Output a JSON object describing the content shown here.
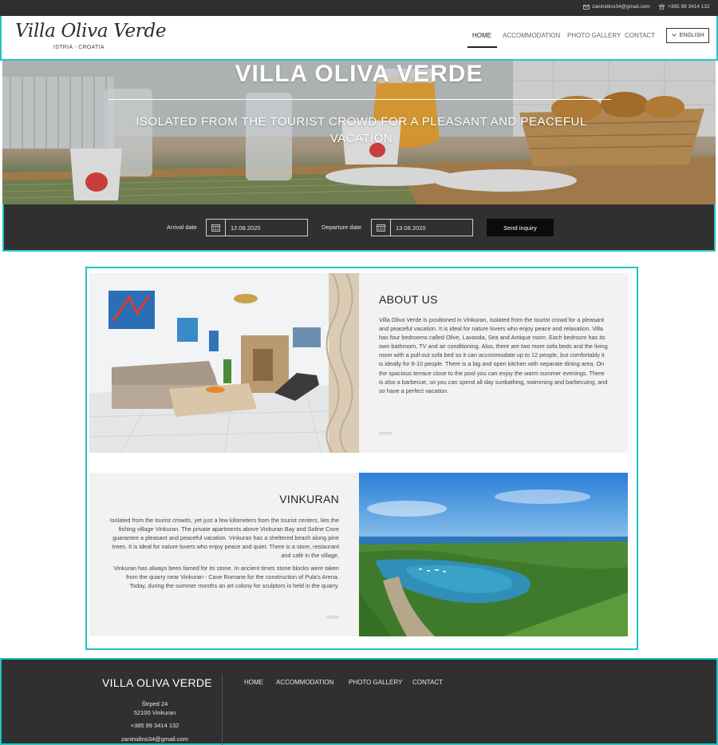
{
  "topbar": {
    "email": "zaninidino34@gmail.com",
    "phone": "+385 99 3414 132"
  },
  "header": {
    "logo_script": "Villa Oliva Verde",
    "logo_sub": "ISTRIA - CROATIA",
    "nav": [
      "HOME",
      "ACCOMMODATION",
      "PHOTO GALLERY",
      "CONTACT"
    ],
    "active_nav": "HOME",
    "language": "ENGLISH"
  },
  "hero": {
    "title": "VILLA OLIVA VERDE",
    "subtitle": "ISOLATED FROM THE TOURIST CROWD FOR A PLEASANT AND PEACEFUL VACATION"
  },
  "booking": {
    "arrival_label": "Arrival date",
    "arrival_value": "12.08.2020",
    "departure_label": "Departure date",
    "departure_value": "13.08.2020",
    "send_label": "Send inquiry"
  },
  "about": {
    "title": "ABOUT US",
    "body": "Villa Oliva Verde is positioned in Vinkuran, isolated from the tourist crowd for a pleasant and peaceful vacation. It is ideal for nature lovers who enjoy peace and relaxation. Villa has four bedrooms called Olive, Lavanda, Sea and Antique room. Each bedroom has its own bathroom, TV and air conditioning. Also, there are two more sofa beds and the living room with a pull-out sofa bed so it can accommodate up to 12 people, but comfortably it is ideally for 8-10 people. There is a big and open kitchen with separate dining area. On the spacious terrace close to the pool you can enjoy the warm summer evenings. There is also a barbecue, so you can spend all day sunbathing, swimming and barbecuing, and so have a perfect vacation.",
    "more": "more"
  },
  "vinkuran": {
    "title": "VINKURAN",
    "p1": "Isolated from the tourist crowds, yet just a few kilometers from the tourist centers, lies the fishing village Vinkuran. The private apartments above Vinkuran Bay and Soline Cove guarantee a pleasant and peaceful vacation. Vinkuran has a sheltered beach along pine trees. It is ideal for nature lovers who enjoy peace and quiet. There is a store, restaurant and café in the village.",
    "p2": "Vinkuran has always been famed for its stone. In ancient times stone blocks were taken from the quarry near Vinkuran - Cave Romane for the construction of Pula's Arena. Today, during the summer months an art colony for sculptors is held in the quarry.",
    "more": "more"
  },
  "footer": {
    "title": "VILLA OLIVA VERDE",
    "street": "Štrped 24",
    "city": "52100 Vinkuran",
    "phone": "+385 99 3414 132",
    "email": "zaninidino34@gmail.com",
    "nav": [
      "HOME",
      "ACCOMMODATION",
      "PHOTO GALLERY",
      "CONTACT"
    ]
  },
  "colors": {
    "accent": "#23c4c4",
    "dark": "#303030"
  }
}
